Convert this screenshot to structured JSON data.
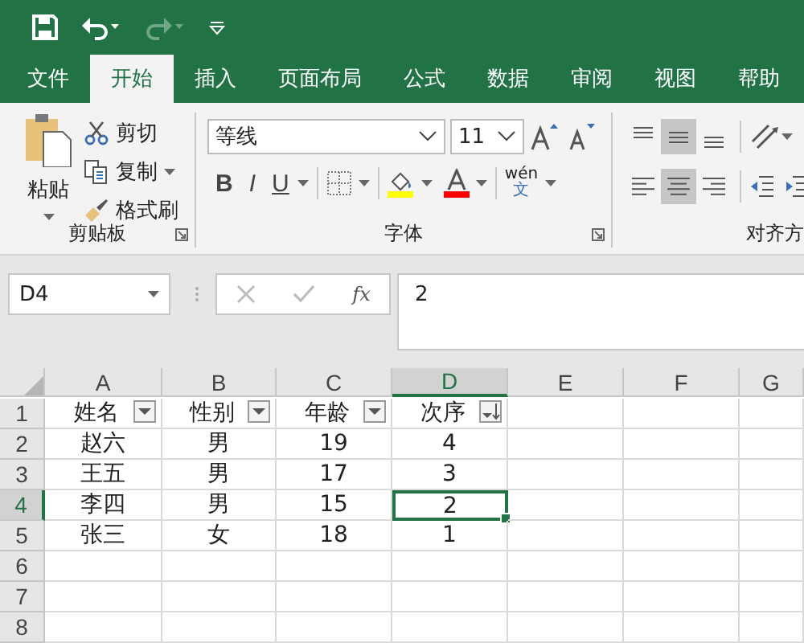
{
  "quick_access": [
    {
      "kind": "save",
      "disabled": false
    },
    {
      "kind": "undo",
      "disabled": false
    },
    {
      "kind": "redo",
      "disabled": true
    },
    {
      "kind": "customize",
      "disabled": false
    }
  ],
  "tabs": [
    {
      "label": "文件",
      "selected": false
    },
    {
      "label": "开始",
      "selected": true
    },
    {
      "label": "插入",
      "selected": false
    },
    {
      "label": "页面布局",
      "selected": false
    },
    {
      "label": "公式",
      "selected": false
    },
    {
      "label": "数据",
      "selected": false
    },
    {
      "label": "审阅",
      "selected": false
    },
    {
      "label": "视图",
      "selected": false
    },
    {
      "label": "帮助",
      "selected": false
    }
  ],
  "ribbon": {
    "clipboard": {
      "label": "剪贴板",
      "paste": "粘贴",
      "cut": "剪切",
      "copy": "复制",
      "format_painter": "格式刷"
    },
    "font": {
      "label": "字体",
      "font_name": "等线",
      "font_size": "11",
      "bold": "B",
      "italic": "I",
      "underline": "U",
      "phonetic_top": "wén",
      "phonetic_bottom": "文"
    },
    "alignment": {
      "label": "对齐方",
      "vertical": [
        {
          "kind": "top",
          "selected": false
        },
        {
          "kind": "middle",
          "selected": true
        },
        {
          "kind": "bottom",
          "selected": false
        }
      ],
      "horizontal": [
        {
          "kind": "left",
          "selected": false
        },
        {
          "kind": "center",
          "selected": true
        },
        {
          "kind": "right",
          "selected": false
        }
      ]
    }
  },
  "formula_bar": {
    "name_box": "D4",
    "function_label": "fx",
    "formula": "2"
  },
  "sheet": {
    "columns": [
      {
        "label": "A",
        "selected": false
      },
      {
        "label": "B",
        "selected": false
      },
      {
        "label": "C",
        "selected": false
      },
      {
        "label": "D",
        "selected": true
      },
      {
        "label": "E",
        "selected": false
      },
      {
        "label": "F",
        "selected": false
      },
      {
        "label": "G",
        "selected": false
      }
    ],
    "rows": [
      {
        "header": "1",
        "selected": false,
        "cells": [
          {
            "text": "姓名",
            "kind": "filter",
            "selected": false
          },
          {
            "text": "性别",
            "kind": "filter",
            "selected": false
          },
          {
            "text": "年龄",
            "kind": "filter",
            "selected": false
          },
          {
            "text": "次序",
            "kind": "sorted_desc",
            "selected": false
          }
        ]
      },
      {
        "header": "2",
        "selected": false,
        "cells": [
          {
            "text": "赵六",
            "selected": false
          },
          {
            "text": "男",
            "selected": false
          },
          {
            "text": "19",
            "selected": false
          },
          {
            "text": "4",
            "selected": false
          }
        ]
      },
      {
        "header": "3",
        "selected": false,
        "cells": [
          {
            "text": "王五",
            "selected": false
          },
          {
            "text": "男",
            "selected": false
          },
          {
            "text": "17",
            "selected": false
          },
          {
            "text": "3",
            "selected": false
          }
        ]
      },
      {
        "header": "4",
        "selected": true,
        "cells": [
          {
            "text": "李四",
            "selected": false
          },
          {
            "text": "男",
            "selected": false
          },
          {
            "text": "15",
            "selected": false
          },
          {
            "text": "2",
            "selected": true
          }
        ]
      },
      {
        "header": "5",
        "selected": false,
        "cells": [
          {
            "text": "张三",
            "selected": false
          },
          {
            "text": "女",
            "selected": false
          },
          {
            "text": "18",
            "selected": false
          },
          {
            "text": "1",
            "selected": false
          }
        ]
      },
      {
        "header": "6",
        "selected": false
      },
      {
        "header": "7",
        "selected": false
      },
      {
        "header": "8",
        "selected": false
      }
    ]
  }
}
